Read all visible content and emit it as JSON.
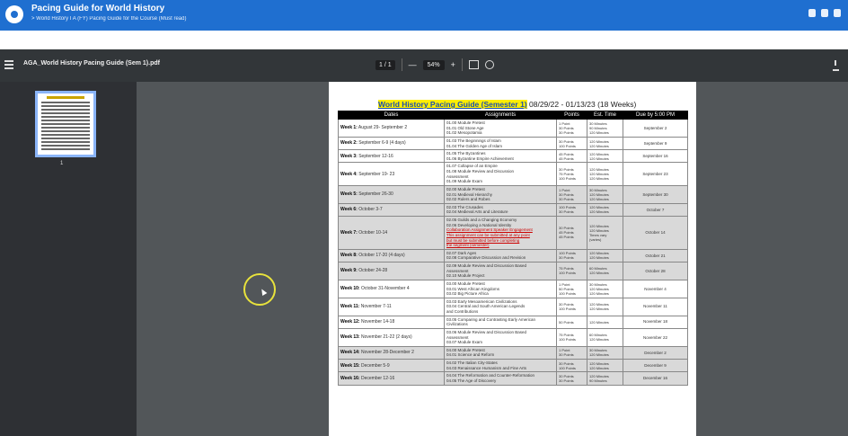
{
  "app": {
    "title": "Pacing Guide for World History",
    "breadcrumb": "> World History I A (FY) Pacing Guide for the Course (Must read)"
  },
  "pdf": {
    "filename": "AGA_World History Pacing Guide (Sem 1).pdf",
    "page_indicator": "1 / 1",
    "zoom": "54%",
    "zoom_out": "—",
    "zoom_in": "+",
    "thumb_page": "1"
  },
  "doc": {
    "title_highlight": "World History Pacing Guide (Semester 1)",
    "title_rest": " 08/29/22 - 01/13/23 (18 Weeks)",
    "headers": [
      "Dates",
      "Assignments",
      "Points",
      "Est. Time",
      "Due by 5:00 PM"
    ],
    "rows": [
      {
        "week": "Week 1:",
        "dates": "August 29- September 2",
        "assign": "01.00 Module Pretest\n01.01 Old Stone Age\n01.02 Mesopotamia",
        "pts": "1 Point\n30 Points\n30 Points",
        "est": "30 Minutes\n90 Minutes\n120 Minutes",
        "due": "September 2",
        "shade": false
      },
      {
        "week": "Week 2:",
        "dates": "September 6-9 (4 days)",
        "assign": "01.03 The Beginnings of Islam\n01.04 The Golden Age of Islam",
        "pts": "30 Points\n100 Points",
        "est": "120 Minutes\n120 Minutes",
        "due": "September 9",
        "shade": false
      },
      {
        "week": "Week 3:",
        "dates": "September 12-16",
        "assign": "01.05 The Byzantines\n01.06 Byzantine Empire Achievement",
        "pts": "45 Points\n45 Points",
        "est": "120 Minutes\n120 Minutes",
        "due": "September 16",
        "shade": false
      },
      {
        "week": "Week 4:",
        "dates": "September 19- 23",
        "assign": "01.07 Collapse of an Empire\n01.08 Module Review and Discussion\nAssessment\n01.09 Module Exam",
        "pts": "30 Points\n75 Points\n100 Points",
        "est": "120 Minutes\n120 Minutes\n120 Minutes",
        "due": "September 23",
        "shade": false
      },
      {
        "week": "Week 5:",
        "dates": "September 26-30",
        "assign": "02.00 Module Pretest\n02.01 Medieval Hierarchy\n02.02 Rulers and Robes",
        "pts": "1 Point\n30 Points\n30 Points",
        "est": "30 Minutes\n120 Minutes\n120 Minutes",
        "due": "September 30",
        "shade": true
      },
      {
        "week": "Week 6:",
        "dates": "October 3-7",
        "assign": "02.03 The Crusades\n02.04 Medieval Arts and Literature",
        "pts": "100 Points\n30 Points",
        "est": "120 Minutes\n120 Minutes",
        "due": "October 7",
        "shade": true
      },
      {
        "week": "Week 7:",
        "dates": "October 10-14",
        "assign": "02.05 Guilds and a Changing Economy\n02.06 Developing a National Identity\nCollaboration Assignment Speaker Engagement\nThis assignment can be submitted at any point\nbut must be submitted before completing\nthe segment (semester)",
        "pts": "30 Points\n45 Points\n45 Points",
        "est": "120 Minutes\n120 Minutes\nTimes vary\n(varies)",
        "due": "October 14",
        "shade": true,
        "red": true
      },
      {
        "week": "Week 8:",
        "dates": "October 17-20 (4 days)",
        "assign": "02.07 Dark Ages\n02.08 Comparative Discussion and Revision",
        "pts": "100 Points\n30 Points",
        "est": "120 Minutes\n120 Minutes",
        "due": "October 21",
        "shade": true
      },
      {
        "week": "Week 9:",
        "dates": "October 24-28",
        "assign": "02.09 Module Review and Discussion Based\nAssessment\n02.10 Module Project",
        "pts": "75 Points\n100 Points",
        "est": "60 Minutes\n120 Minutes",
        "due": "October 28",
        "shade": true
      },
      {
        "week": "Week 10:",
        "dates": "October 31-November 4",
        "assign": "03.00 Module Pretest\n03.01 West African Kingdoms\n03.02 Big Picture Africa",
        "pts": "1 Point\n50 Points\n100 Points",
        "est": "30 Minutes\n120 Minutes\n120 Minutes",
        "due": "November 4",
        "shade": false
      },
      {
        "week": "Week 11:",
        "dates": "November 7-11",
        "assign": "03.03 Early Mesoamerican Civilizations\n03.04 Central and South American Legends\nand Contributions",
        "pts": "30 Points\n100 Points",
        "est": "120 Minutes\n120 Minutes",
        "due": "November 11",
        "shade": false
      },
      {
        "week": "Week 12:",
        "dates": "November 14-18",
        "assign": "03.05 Comparing and Contrasting Early American\nCivilizations",
        "pts": "50 Points",
        "est": "120 Minutes",
        "due": "November 18",
        "shade": false
      },
      {
        "week": "Week 13:",
        "dates": "November 21-22 (2 days)",
        "assign": "03.06 Module Review and Discussion Based\nAssessment\n03.07 Module Exam",
        "pts": "75 Points\n100 Points",
        "est": "60 Minutes\n120 Minutes",
        "due": "November 22",
        "shade": false
      },
      {
        "week": "Week 14:",
        "dates": "November 28-December 2",
        "assign": "04.00 Module Pretest\n04.01 Science and Reform",
        "pts": "1 Point\n30 Points",
        "est": "30 Minutes\n120 Minutes",
        "due": "December 2",
        "shade": true
      },
      {
        "week": "Week 15:",
        "dates": "December 5-9",
        "assign": "04.02 The Italian City-States\n04.03 Renaissance Humanism and Fine Arts",
        "pts": "30 Points\n100 Points",
        "est": "120 Minutes\n120 Minutes",
        "due": "December 9",
        "shade": true
      },
      {
        "week": "Week 16:",
        "dates": "December 12-16",
        "assign": "04.04 The Reformation and Counter-Reformation\n04.05 The Age of Discovery",
        "pts": "30 Points\n30 Points",
        "est": "120 Minutes\n90 Minutes",
        "due": "December 16",
        "shade": true
      }
    ]
  }
}
